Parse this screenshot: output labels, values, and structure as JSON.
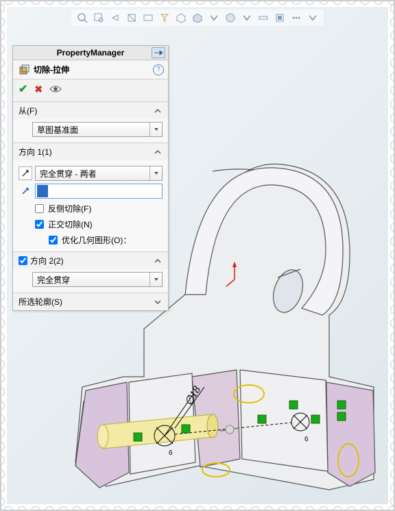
{
  "panel": {
    "title": "PropertyManager",
    "feature_title": "切除-拉伸",
    "sections": {
      "from": {
        "label": "从(F)",
        "value": "草图基准面"
      },
      "dir1": {
        "label": "方向 1(1)",
        "end_condition": "完全贯穿 - 两者",
        "flip_side": "反侧切除(F)",
        "normal_cut": "正交切除(N)",
        "optimize": "优化几何图形(O)："
      },
      "dir2": {
        "label": "方向 2(2)",
        "end_condition": "完全贯穿"
      },
      "contours": {
        "label": "所选轮廓(S)"
      }
    }
  },
  "dimension": {
    "label": "∅18",
    "value": "6"
  }
}
